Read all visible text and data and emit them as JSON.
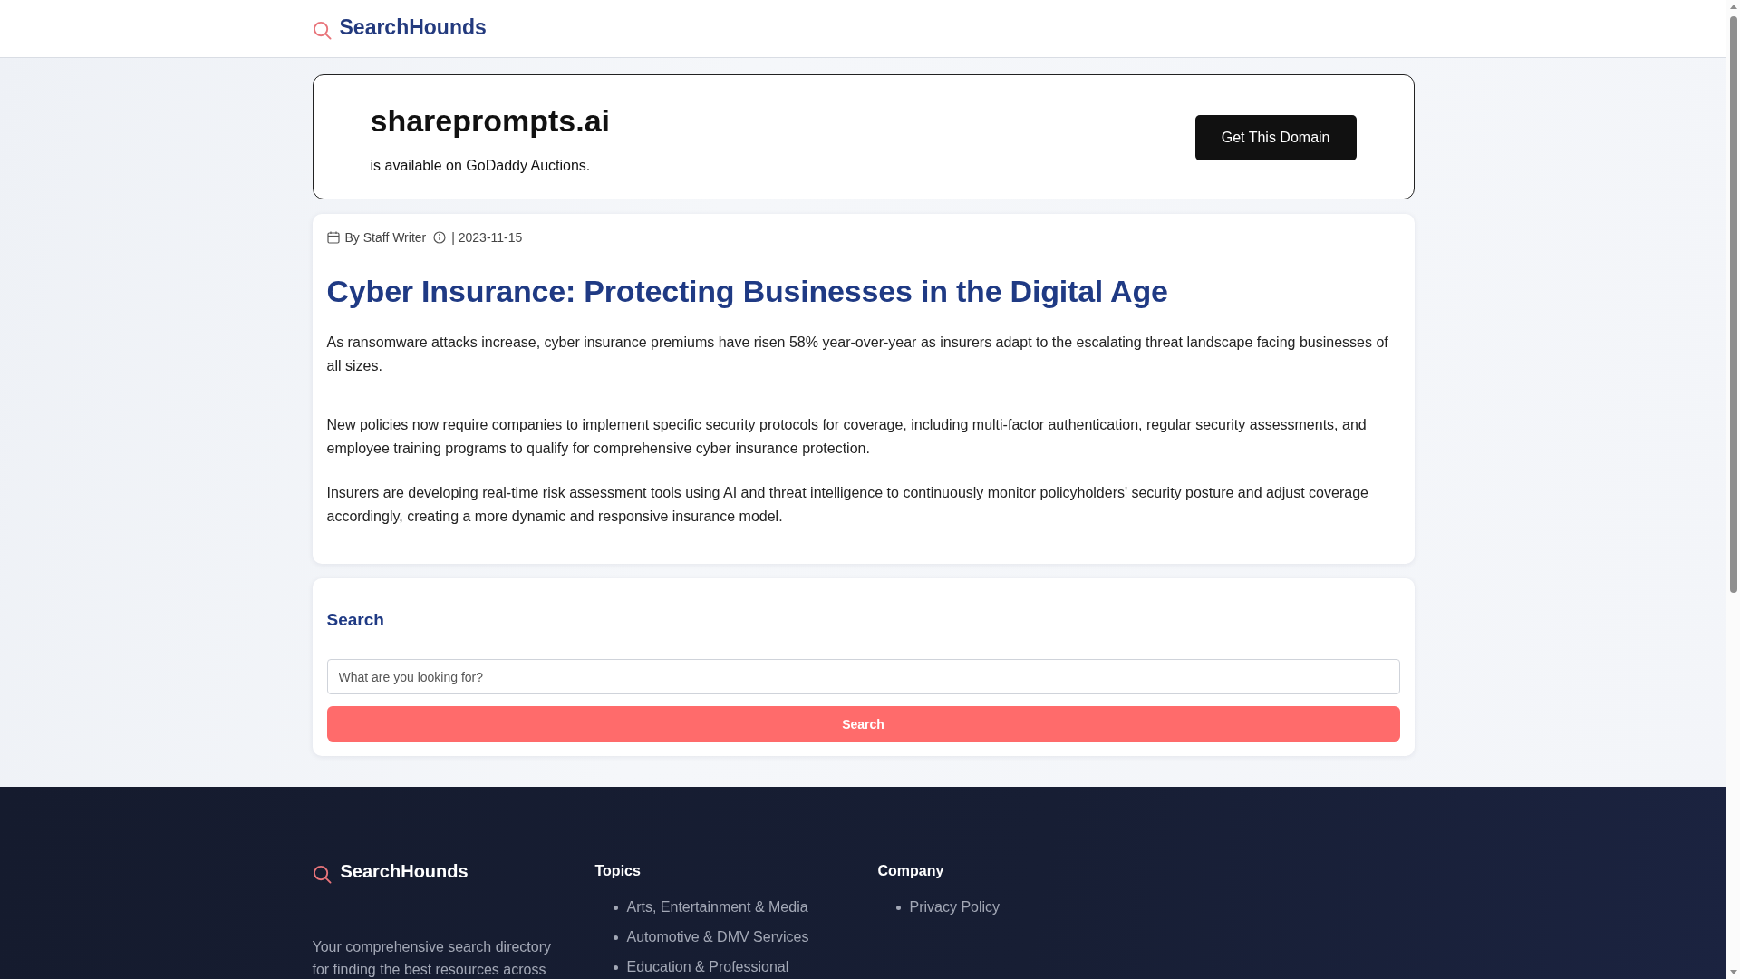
{
  "header": {
    "logo": "SearchHounds"
  },
  "domain_banner": {
    "domain": "shareprompts.ai",
    "note": "is available on GoDaddy Auctions.",
    "button": "Get This Domain"
  },
  "article": {
    "author": "By Staff Writer",
    "date": "| 2023-11-15",
    "title": "Cyber Insurance: Protecting Businesses in the Digital Age",
    "paragraphs": [
      "As ransomware attacks increase, cyber insurance premiums have risen 58% year-over-year as insurers adapt to the escalating threat landscape facing businesses of all sizes.",
      "New policies now require companies to implement specific security protocols for coverage, including multi-factor authentication, regular security assessments, and employee training programs to qualify for comprehensive cyber insurance protection.",
      "Insurers are developing real-time risk assessment tools using AI and threat intelligence to continuously monitor policyholders' security posture and adjust coverage accordingly, creating a more dynamic and responsive insurance model."
    ]
  },
  "search": {
    "heading": "Search",
    "placeholder": "What are you looking for?",
    "button": "Search"
  },
  "footer": {
    "logo": "SearchHounds",
    "description": "Your comprehensive search directory for finding the best resources across",
    "columns": [
      {
        "heading": "Topics",
        "links": [
          "Arts, Entertainment & Media",
          "Automotive & DMV Services",
          "Education & Professional"
        ]
      },
      {
        "heading": "Company",
        "links": [
          "Privacy Policy"
        ]
      }
    ]
  }
}
